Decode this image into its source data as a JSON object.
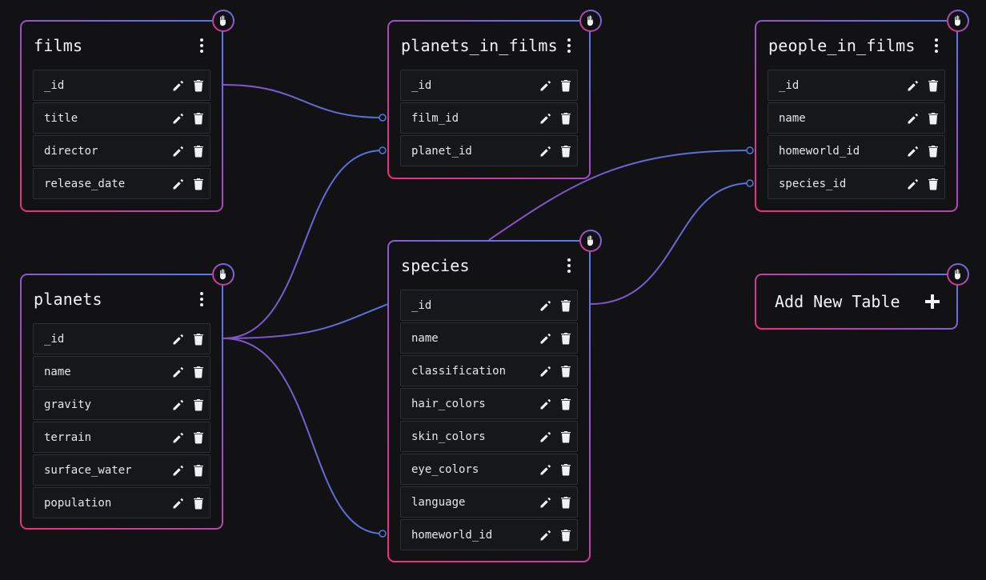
{
  "colors": {
    "background": "#121214",
    "border_pink": "#ee2f7a",
    "border_purple": "#a54bc4",
    "border_blue": "#4e7df0",
    "edge_blue": "#4f78e0",
    "edge_purple": "#8a4fc8"
  },
  "icons": {
    "grip": "hand-grab-icon",
    "menu": "kebab-menu-icon",
    "edit": "pencil-icon",
    "delete": "trash-icon",
    "add": "plus-icon"
  },
  "tables": [
    {
      "id": "films",
      "name": "films",
      "fields": [
        "_id",
        "title",
        "director",
        "release_date"
      ]
    },
    {
      "id": "planets_in_films",
      "name": "planets_in_films",
      "fields": [
        "_id",
        "film_id",
        "planet_id"
      ]
    },
    {
      "id": "people_in_films",
      "name": "people_in_films",
      "fields": [
        "_id",
        "name",
        "homeworld_id",
        "species_id"
      ]
    },
    {
      "id": "planets",
      "name": "planets",
      "fields": [
        "_id",
        "name",
        "gravity",
        "terrain",
        "surface_water",
        "population"
      ]
    },
    {
      "id": "species",
      "name": "species",
      "fields": [
        "_id",
        "name",
        "classification",
        "hair_colors",
        "skin_colors",
        "eye_colors",
        "language",
        "homeworld_id"
      ]
    }
  ],
  "add_table": {
    "label": "Add New Table"
  }
}
